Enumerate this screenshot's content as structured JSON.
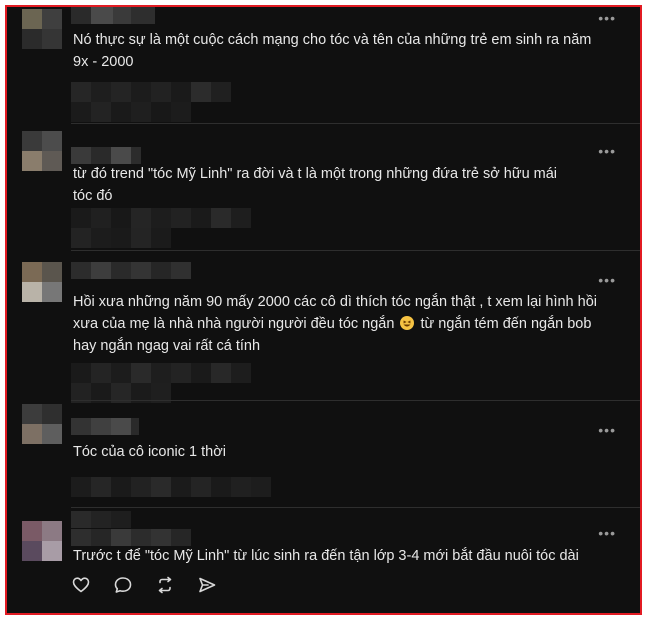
{
  "more_label": "•••",
  "comments": [
    {
      "text_line1": "Nó thực sự là một cuộc cách mạng cho tóc và tên của những trẻ em sinh ra năm",
      "text_line2": "9x - 2000"
    },
    {
      "text_line1": "từ đó trend \"tóc Mỹ Linh\" ra đời và t là một trong những đứa trẻ sở hữu mái",
      "text_line2": "tóc đó"
    },
    {
      "text_line1": "Hồi xưa những năm 90 mấy 2000 các cô dì thích tóc ngắn thật , t xem lại hình hồi",
      "text_line2a": "xưa của mẹ là nhà nhà người người đều tóc ngắn",
      "text_line2b": "từ ngắn tém đến ngắn bob",
      "text_line3": "hay ngắn ngag vai rất cá tính"
    },
    {
      "text_line1": "Tóc của cô iconic 1 thời"
    },
    {
      "text_line1": "Trước t để \"tóc Mỹ Linh\" từ lúc sinh ra đến tận lớp 3-4 mới bắt đầu nuôi tóc dài"
    }
  ],
  "actions": {
    "like_icon": "heart-icon",
    "reply_icon": "comment-bubble-icon",
    "repost_icon": "repost-icon",
    "share_icon": "send-icon"
  },
  "emoji_icon": "grinning-squint-emoji",
  "colors": {
    "background": "#101010",
    "border": "#e21b23",
    "text": "#e8e8e8",
    "muted": "#9a9a9a"
  }
}
